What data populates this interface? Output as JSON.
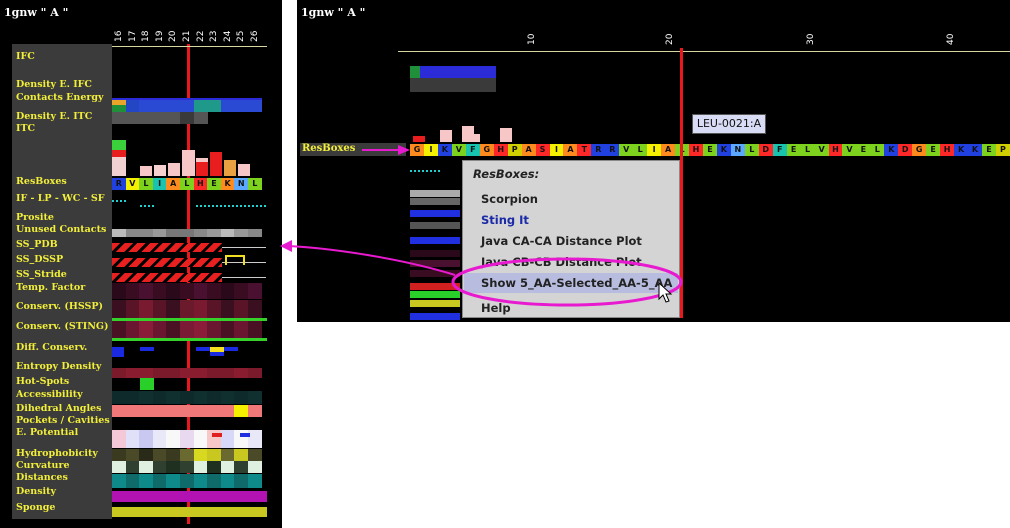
{
  "left_panel": {
    "title": "1gnw \" A \"",
    "column_numbers": [
      "16",
      "17",
      "18",
      "19",
      "20",
      "21",
      "22",
      "23",
      "24",
      "25",
      "26"
    ],
    "residues": [
      "R",
      "V",
      "L",
      "I",
      "A",
      "L",
      "H",
      "E",
      "K",
      "N",
      "L"
    ],
    "track_labels": [
      "IFC",
      "Density E. IFC",
      "Contacts Energy",
      "Density E. ITC",
      "ITC",
      "ResBoxes",
      "IF - LP - WC - SF",
      "Prosite",
      "Unused Contacts",
      "SS_PDB",
      "SS_DSSP",
      "SS_Stride",
      "Temp. Factor",
      "Conserv. (HSSP)",
      "Conserv. (STING)",
      "Diff. Conserv.",
      "Entropy Density",
      "Hot-Spots",
      "Accessibility",
      "Dihedral Angles",
      "Pockets / Cavities",
      "E. Potential",
      "Hydrophobicity",
      "Curvature",
      "Distances",
      "Density",
      "Sponge"
    ]
  },
  "right_panel": {
    "title": "1gnw \" A \"",
    "ruler_numbers": [
      "10",
      "20",
      "30",
      "40"
    ],
    "resboxes_label": "ResBoxes",
    "residues": [
      "G",
      "I",
      "K",
      "V",
      "F",
      "G",
      "H",
      "P",
      "A",
      "S",
      "I",
      "A",
      "T",
      "R",
      "R",
      "V",
      "L",
      "I",
      "A",
      "L",
      "H",
      "E",
      "K",
      "N",
      "L",
      "D",
      "F",
      "E",
      "L",
      "V",
      "H",
      "V",
      "E",
      "L",
      "K",
      "D",
      "G",
      "E",
      "H",
      "K",
      "K",
      "E",
      "P"
    ],
    "tooltip": "LEU-0021:A"
  },
  "context_menu": {
    "title": "ResBoxes:",
    "items": [
      "Scorpion",
      "Sting It",
      "Java CA-CA Distance Plot",
      "Java CB-CB Distance Plot",
      "Show 5_AA-Selected_AA-5_AA",
      "Help"
    ],
    "highlighted_item": "Show 5_AA-Selected_AA-5_AA"
  },
  "colors": {
    "background": "#000000",
    "label_text": "#f2ef3a",
    "selection_line": "#e8181c",
    "annotation": "#e81ad0",
    "menu_bg": "#d4d4d4",
    "menu_link": "#1a2aa8"
  },
  "icons": [
    "mouse-pointer-icon",
    "annotation-arrow-icon"
  ]
}
